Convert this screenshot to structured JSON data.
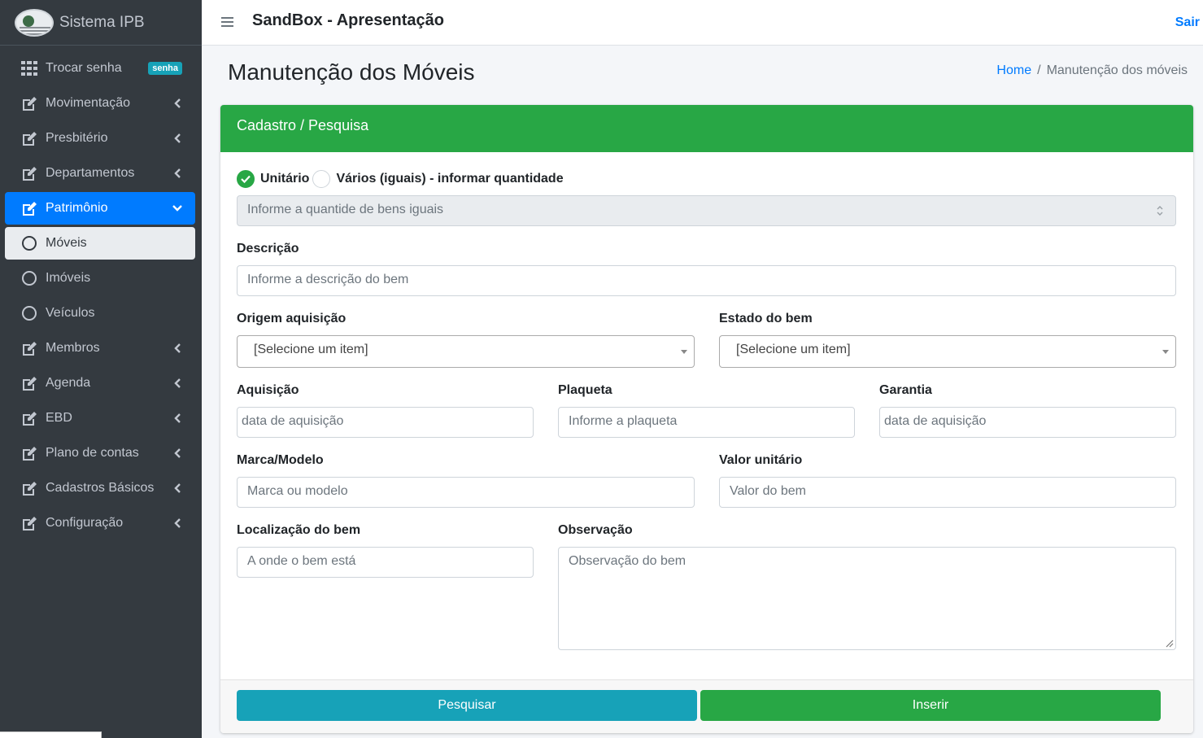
{
  "brand": {
    "name": "Sistema IPB"
  },
  "sidebar": {
    "items": [
      {
        "label": "Trocar senha",
        "badge": "senha"
      },
      {
        "label": "Movimentação"
      },
      {
        "label": "Presbitério"
      },
      {
        "label": "Departamentos"
      },
      {
        "label": "Patrimônio"
      },
      {
        "label": "Móveis"
      },
      {
        "label": "Imóveis"
      },
      {
        "label": "Veículos"
      },
      {
        "label": "Membros"
      },
      {
        "label": "Agenda"
      },
      {
        "label": "EBD"
      },
      {
        "label": "Plano de contas"
      },
      {
        "label": "Cadastros Básicos"
      },
      {
        "label": "Configuração"
      }
    ]
  },
  "topbar": {
    "title": "SandBox - Apresentação",
    "logout": "Sair"
  },
  "page": {
    "title": "Manutenção dos Móveis",
    "breadcrumb": {
      "home": "Home",
      "separator": "/",
      "current": "Manutenção dos móveis"
    }
  },
  "card": {
    "header": "Cadastro / Pesquisa"
  },
  "form": {
    "radio_unitario": "Unitário",
    "radio_varios": "Vários (iguais) - informar quantidade",
    "quantidade_placeholder": "Informe a quantide de bens iguais",
    "descricao_label": "Descrição",
    "descricao_placeholder": "Informe a descrição do bem",
    "origem_label": "Origem aquisição",
    "origem_value": "[Selecione um item]",
    "estado_label": "Estado do bem",
    "estado_value": "[Selecione um item]",
    "aquisicao_label": "Aquisição",
    "aquisicao_placeholder": "data de aquisição",
    "plaqueta_label": "Plaqueta",
    "plaqueta_placeholder": "Informe a plaqueta",
    "garantia_label": "Garantia",
    "garantia_placeholder": "data de aquisição",
    "marca_label": "Marca/Modelo",
    "marca_placeholder": "Marca ou modelo",
    "valor_label": "Valor unitário",
    "valor_placeholder": "Valor do bem",
    "localizacao_label": "Localização do bem",
    "localizacao_placeholder": "A onde o bem está",
    "observacao_label": "Observação",
    "observacao_placeholder": "Observação do bem"
  },
  "buttons": {
    "pesquisar": "Pesquisar",
    "inserir": "Inserir"
  },
  "colors": {
    "sidebar": "#343a40",
    "primary": "#007bff",
    "success": "#28a745",
    "info": "#17a2b8"
  }
}
